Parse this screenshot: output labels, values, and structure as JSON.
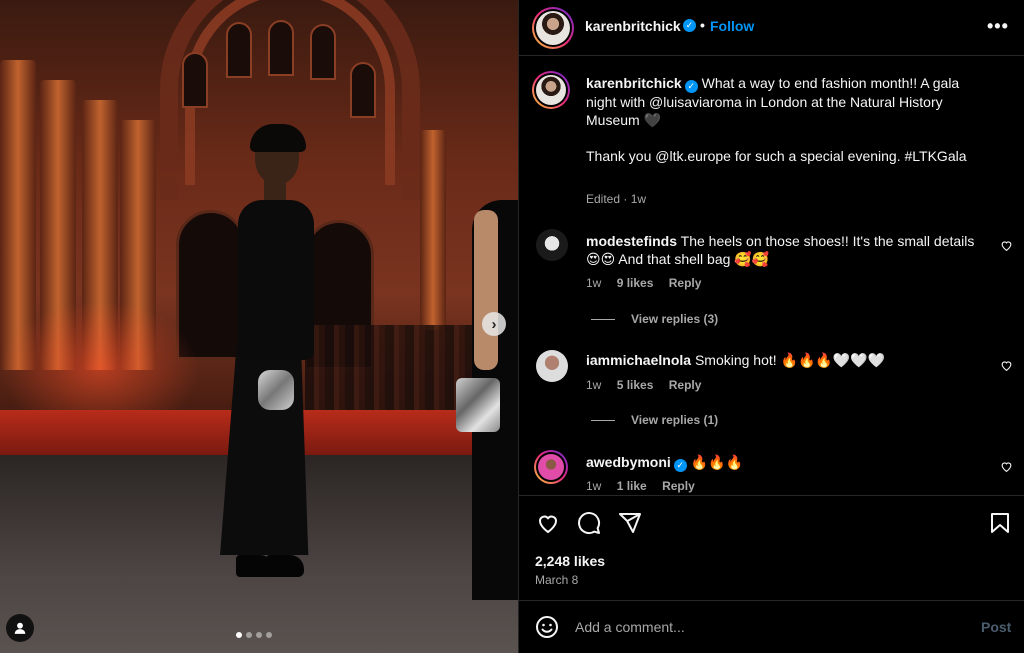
{
  "header": {
    "username": "karenbritchick",
    "separator": "•",
    "follow_label": "Follow",
    "more_label": "•••"
  },
  "caption": {
    "username": "karenbritchick",
    "line1": "What a way to end fashion month!! A gala night with @luisaviaroma in London at the Natural History Museum 🖤",
    "line2": "Thank you @ltk.europe for such a special evening. #LTKGala",
    "meta": "Edited · 1w"
  },
  "comments": [
    {
      "username": "modestefinds",
      "text": "The heels on those shoes!! It's the small details 😍😍 And that shell bag 🥰🥰",
      "time": "1w",
      "likes": "9 likes",
      "reply": "Reply",
      "view_replies": "View replies (3)"
    },
    {
      "username": "iammichaelnola",
      "text": "Smoking hot! 🔥🔥🔥🤍🤍🤍",
      "time": "1w",
      "likes": "5 likes",
      "reply": "Reply",
      "view_replies": "View replies (1)"
    },
    {
      "username": "awedbymoni",
      "text": "🔥🔥🔥",
      "time": "1w",
      "likes": "1 like",
      "reply": "Reply"
    }
  ],
  "actions": {
    "likes": "2,248 likes",
    "date": "March 8"
  },
  "composer": {
    "placeholder": "Add a comment...",
    "post_label": "Post"
  },
  "carousel": {
    "next_label": "›",
    "slide_count": 4,
    "active_slide": 1
  },
  "colors": {
    "accent": "#0095f6",
    "background": "#000000",
    "muted": "#a8a8a8"
  },
  "icons": [
    "heart-icon",
    "comment-icon",
    "share-icon",
    "save-icon",
    "emoji-icon",
    "user-tag-icon",
    "verified-icon",
    "chevron-right-icon"
  ]
}
